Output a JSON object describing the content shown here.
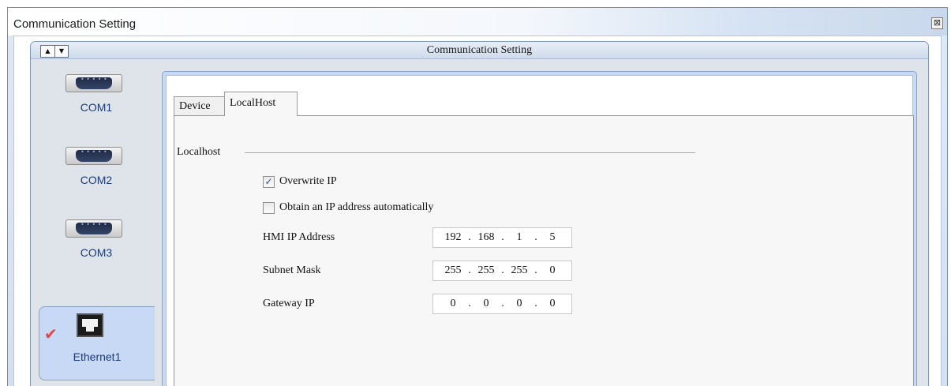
{
  "window": {
    "title": "Communication Setting",
    "close_glyph": "⊠"
  },
  "panel": {
    "title": "Communication Setting",
    "up_glyph": "▲",
    "down_glyph": "▼"
  },
  "sidebar": {
    "items": [
      {
        "label": "COM1",
        "icon": "serial-port-icon"
      },
      {
        "label": "COM2",
        "icon": "serial-port-icon"
      },
      {
        "label": "COM3",
        "icon": "serial-port-icon"
      },
      {
        "label": "Ethernet1",
        "icon": "ethernet-port-icon",
        "selected": true,
        "check_glyph": "✔"
      }
    ]
  },
  "tabs": [
    {
      "label": "Device",
      "active": false
    },
    {
      "label": "LocalHost",
      "active": true
    }
  ],
  "localhost": {
    "group_label": "Localhost",
    "overwrite_ip": {
      "label": "Overwrite IP",
      "checked": true,
      "glyph": "✓"
    },
    "obtain_auto": {
      "label": "Obtain an IP address automatically",
      "checked": false
    },
    "hmi_ip": {
      "label": "HMI IP Address",
      "octets": [
        "192",
        "168",
        "1",
        "5"
      ]
    },
    "subnet": {
      "label": "Subnet Mask",
      "octets": [
        "255",
        "255",
        "255",
        "0"
      ]
    },
    "gateway": {
      "label": "Gateway IP",
      "octets": [
        "0",
        "0",
        "0",
        "0"
      ]
    },
    "separator": "."
  },
  "colors": {
    "accent": "#c7d9f4",
    "label_blue": "#1e3a78",
    "check_red": "#e24545"
  }
}
